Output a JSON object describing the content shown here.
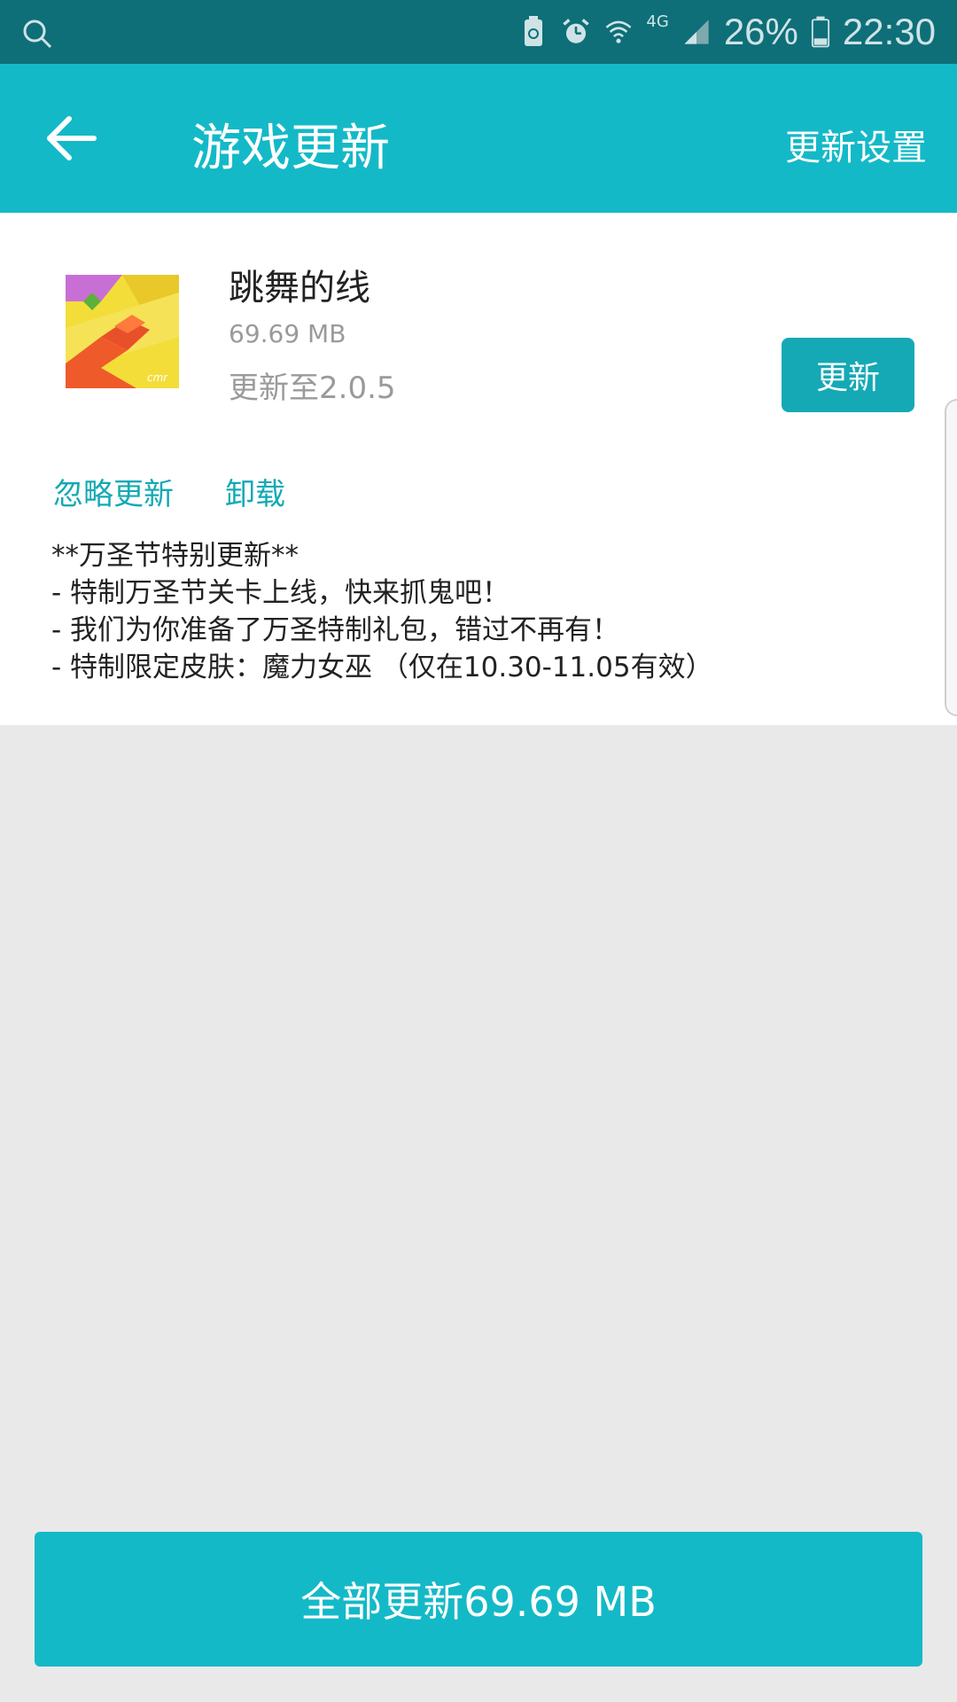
{
  "status_bar": {
    "battery_percent": "26%",
    "time": "22:30",
    "network_label": "4G",
    "icons": [
      "search-icon",
      "battery-saver-icon",
      "alarm-icon",
      "wifi-icon",
      "signal-icon",
      "battery-icon"
    ]
  },
  "header": {
    "title": "游戏更新",
    "settings_label": "更新设置",
    "back_icon": "arrow-left-icon"
  },
  "app": {
    "name": "跳舞的线",
    "size": "69.69 MB",
    "version_text": "更新至2.0.5",
    "update_label": "更新",
    "ignore_label": "忽略更新",
    "uninstall_label": "卸载",
    "changelog": [
      "**万圣节特别更新**",
      "- 特制万圣节关卡上线，快来抓鬼吧！",
      "- 我们为你准备了万圣特制礼包，错过不再有！",
      "- 特制限定皮肤：魔力女巫 （仅在10.30-11.05有效）"
    ]
  },
  "footer": {
    "update_all_label": "全部更新69.69 MB"
  },
  "colors": {
    "status_bar": "#0e6f78",
    "header": "#14b9c7",
    "accent": "#14a9b5",
    "background": "#e9e9e9"
  }
}
